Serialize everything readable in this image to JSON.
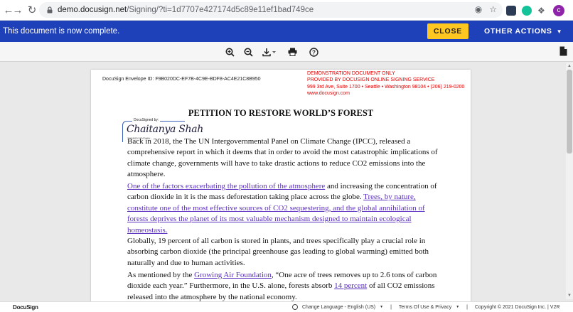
{
  "browser": {
    "url_host": "demo.docusign.net",
    "url_path": "/Signing/?ti=1d7707e427174d5c89e11ef1bad749ce",
    "avatar_letter": "c"
  },
  "banner": {
    "message": "This document is now complete.",
    "close_label": "CLOSE",
    "other_actions_label": "OTHER ACTIONS",
    "color": "#1e40b8",
    "close_color": "#ffc820"
  },
  "document": {
    "envelope_id": "DocuSign Envelope ID: F9B020DC-EF7B-4C9E-BDF8-AC4E21C8B950",
    "demo_lines": [
      "DEMONSTRATION DOCUMENT ONLY",
      "PROVIDED BY DOCUSIGN ONLINE SIGNING SERVICE",
      "999 3rd Ave, Suite 1700  • Seattle • Washington 98104 • (206) 219-0200",
      "www.docusign.com"
    ],
    "title": "PETITION TO RESTORE WORLD’S FOREST",
    "signature": {
      "label": "DocuSigned by:",
      "name": "Chaitanya Shah",
      "id": "7481B5D13DF348A..."
    },
    "p1": "Back in 2018, the The UN Intergovernmental Panel on Climate Change (IPCC), released a comprehensive report in which it deems that in order to avoid the most catastrophic implications of climate change, governments will have to take drastic actions to reduce CO2 emissions into the atmosphere.",
    "p2_link1": "One of the factors exacerbating the pollution of the atmosphere",
    "p2_text": " and increasing the concentration of carbon dioxide in it is the mass deforestation taking place across the globe. ",
    "p2_link2": "Trees, by nature, constitute one of the most effective sources of CO2 sequestering, and the global annihilation of forests deprives the planet of its most valuable mechanism designed to maintain ecological homeostasis.",
    "p3": "Globally, 19 percent of all carbon is stored in plants, and trees specifically play a crucial role in absorbing carbon dioxide (the principal greenhouse gas leading to global warming) emitted both naturally and due to human activities.",
    "p4_a": "As mentioned by the ",
    "p4_link1": "Growing Air Foundation",
    "p4_b": ", “One acre of trees removes up to 2.6 tons of carbon dioxide each year.” Furthermore, in the U.S. alone, forests absorb ",
    "p4_link2": "14 percent",
    "p4_c": " of all CO2 emissions released into the atmosphere by the national economy."
  },
  "footer": {
    "logo": "DocuSign",
    "change_language": "Change Language - English (US)",
    "terms": "Terms Of Use & Privacy",
    "copyright": "Copyright © 2021 DocuSign Inc. | V2R",
    "separator": "|"
  }
}
